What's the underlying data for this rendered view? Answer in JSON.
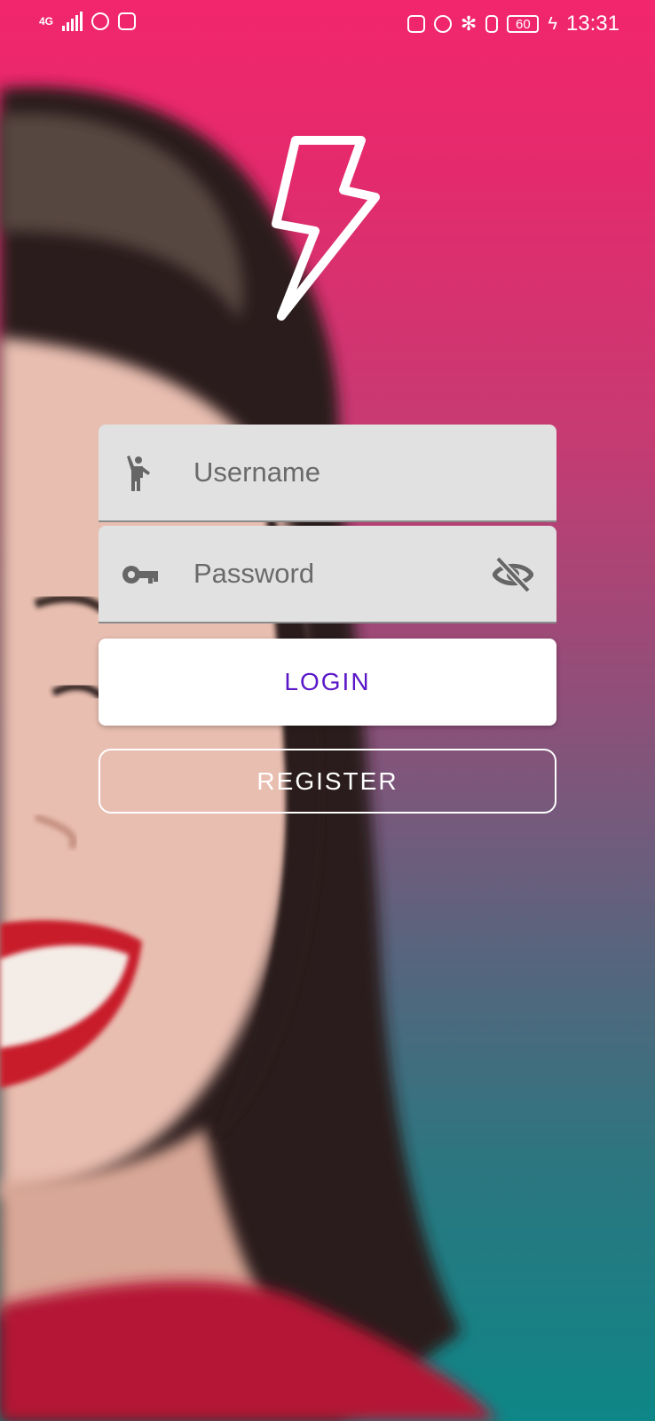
{
  "status_bar": {
    "network": "4G",
    "battery": "60",
    "time": "13:31"
  },
  "login_form": {
    "username_placeholder": "Username",
    "password_placeholder": "Password",
    "login_label": "LOGIN",
    "register_label": "REGISTER"
  },
  "icons": {
    "logo": "lightning-bolt-icon",
    "username": "person-waving-icon",
    "password": "key-icon",
    "visibility": "eye-off-icon"
  },
  "colors": {
    "gradient_top": "#f2266c",
    "gradient_bottom": "#0e8687",
    "login_text": "#5a17c8",
    "field_background": "#e1e1e1"
  }
}
